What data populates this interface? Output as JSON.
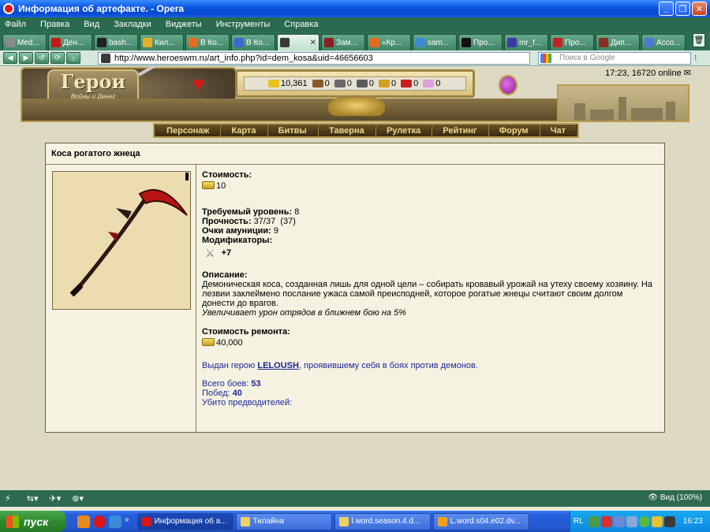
{
  "window": {
    "title": "Информация об артефакте. - Opera"
  },
  "menu": [
    "Файл",
    "Правка",
    "Вид",
    "Закладки",
    "Виджеты",
    "Инструменты",
    "Справка"
  ],
  "tabs": [
    {
      "label": "Med...",
      "color": "#8a8a8a"
    },
    {
      "label": "Ден...",
      "color": "#c81818"
    },
    {
      "label": "bash...",
      "color": "#222222"
    },
    {
      "label": "Кил...",
      "color": "#e8b020"
    },
    {
      "label": "В Ко...",
      "color": "#e86a1e"
    },
    {
      "label": "В Ко...",
      "color": "#3a6ad8"
    },
    {
      "label": "",
      "color": "#3a3a3a",
      "active": true
    },
    {
      "label": "Зам...",
      "color": "#8a2020"
    },
    {
      "label": "«Кр...",
      "color": "#e86a1e"
    },
    {
      "label": "sam...",
      "color": "#3a8ad8"
    },
    {
      "label": "Про...",
      "color": "#111111"
    },
    {
      "label": "mr_f...",
      "color": "#3a3aa8"
    },
    {
      "label": "Про...",
      "color": "#c82020"
    },
    {
      "label": "Дип...",
      "color": "#8a3020"
    },
    {
      "label": "Acco...",
      "color": "#4a7ad8"
    }
  ],
  "address": {
    "url": "http://www.heroeswm.ru/art_info.php?id=dem_kosa&uid=46656603",
    "search_placeholder": "Поиск в Google"
  },
  "game": {
    "logo_title": "Герои",
    "logo_sub": "Войны и Денег",
    "time_online": "17:23, 16720 online",
    "resources": [
      {
        "value": "10,361",
        "color": "#e8c020"
      },
      {
        "value": "0",
        "color": "#8a5a2a"
      },
      {
        "value": "0",
        "color": "#6a6a6a"
      },
      {
        "value": "0",
        "color": "#5a5a5a"
      },
      {
        "value": "0",
        "color": "#d8a020"
      },
      {
        "value": "0",
        "color": "#c82020"
      },
      {
        "value": "0",
        "color": "#e0a0e0"
      }
    ],
    "nav": [
      "Персонаж",
      "Карта",
      "Битвы",
      "Таверна",
      "Рулетка",
      "Рейтинг",
      "Форум",
      "Чат"
    ]
  },
  "artifact": {
    "name": "Коса рогатого жнеца",
    "cost_label": "Стоимость:",
    "cost_value": "10",
    "level_label": "Требуемый уровень:",
    "level_value": "8",
    "durability_label": "Прочность:",
    "durability_value": "37/37  (37)",
    "ammo_label": "Очки амуниции:",
    "ammo_value": "9",
    "modifiers_label": "Модификаторы:",
    "modifier_value": "+7",
    "description_label": "Описание:",
    "description": "Демоническая коса, созданная лишь для одной цели – собирать кровавый урожай на утеху своему хозяину. На лезвии заклеймено послание ужаса самой преисподней, которое рогатые жнецы считают своим долгом донести до врагов.",
    "effect": "Увеличивает урон отрядов в ближнем бою на 5%",
    "repair_label": "Стоимость ремонта:",
    "repair_value": "40,000",
    "issued_prefix": "Выдан герою",
    "issued_hero": "LELOUSH",
    "issued_suffix": ", проявившему себя в боях против демонов.",
    "battles_label": "Всего боев:",
    "battles_value": "53",
    "wins_label": "Побед:",
    "wins_value": "40",
    "leaders_label": "Убито предводителей:"
  },
  "status": {
    "zoom": "Вид (100%)"
  },
  "taskbar": {
    "start": "пуск",
    "buttons": [
      {
        "label": "Информация об а...",
        "color": "#d81818",
        "active": true
      },
      {
        "label": "Тилайна",
        "color": "#f0d060"
      },
      {
        "label": "l.word.season.4.d...",
        "color": "#f0d060"
      },
      {
        "label": "L.word.s04.e02.dv...",
        "color": "#f0a020"
      }
    ],
    "lang": "RL",
    "clock": "16:23"
  }
}
